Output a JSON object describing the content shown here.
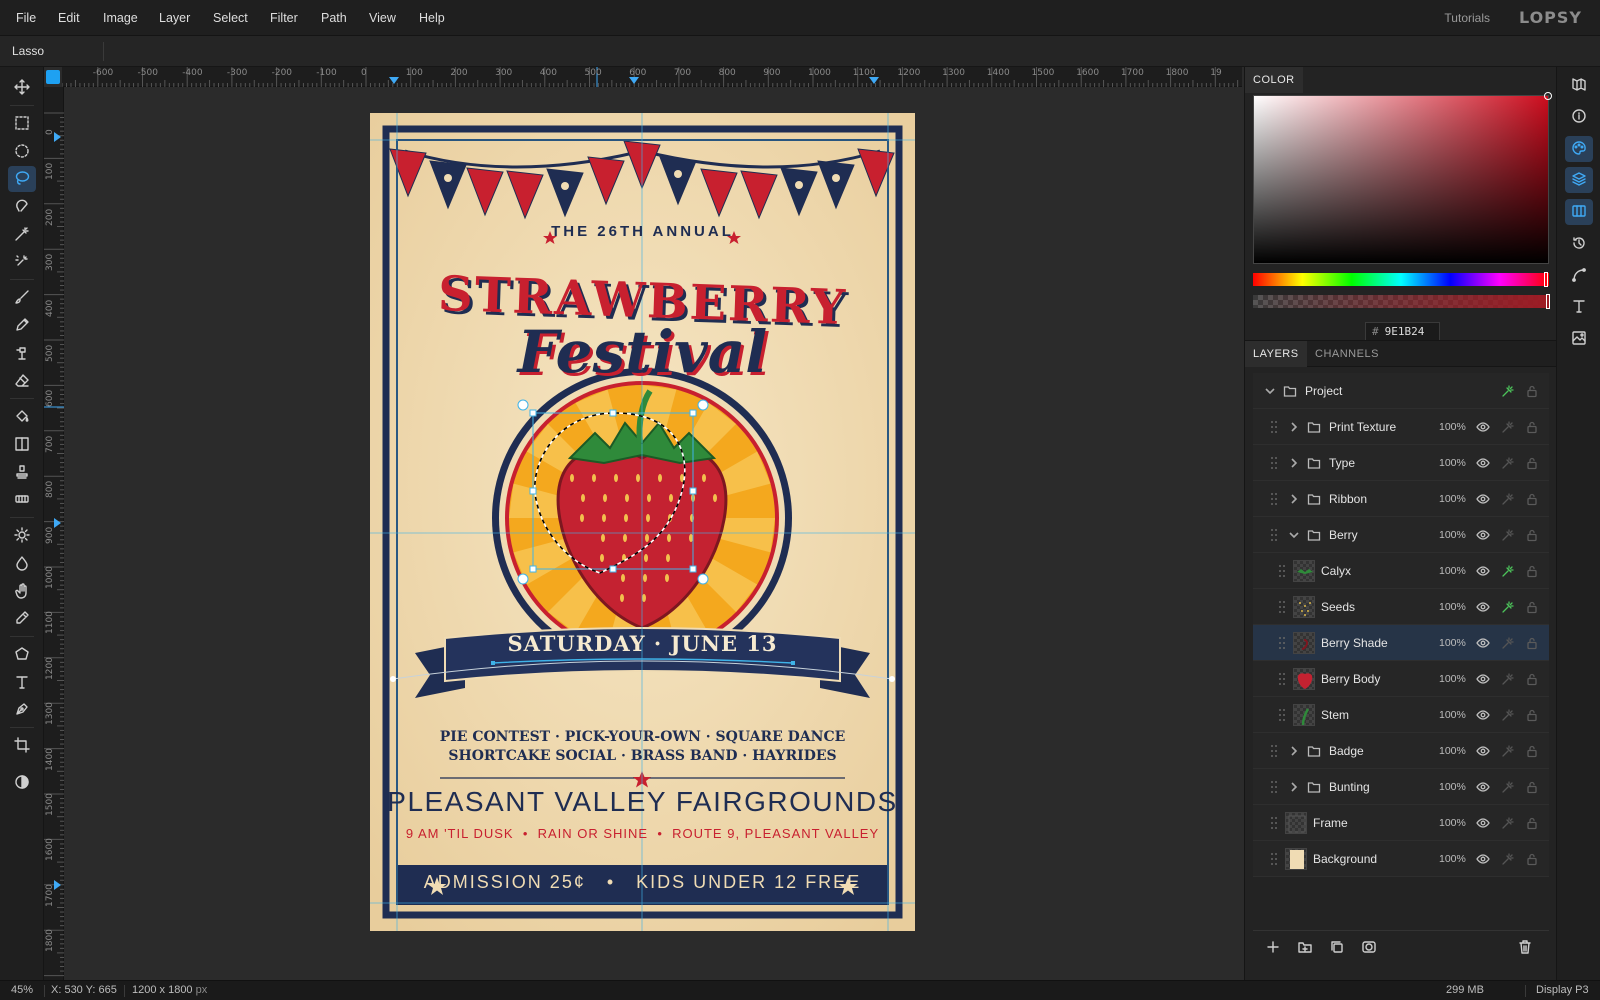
{
  "menu": {
    "items": [
      "File",
      "Edit",
      "Image",
      "Layer",
      "Select",
      "Filter",
      "Path",
      "View",
      "Help"
    ],
    "tutorials": "Tutorials",
    "logo": "LOPSY"
  },
  "options": {
    "tool_name": "Lasso"
  },
  "tools": [
    {
      "name": "move-icon"
    },
    {
      "name": "rect-select-icon"
    },
    {
      "name": "ellipse-select-icon"
    },
    {
      "name": "lasso-icon",
      "active": true
    },
    {
      "name": "magnetic-lasso-icon"
    },
    {
      "name": "magic-wand-icon"
    },
    {
      "name": "quick-select-icon"
    },
    {
      "name": "brush-icon"
    },
    {
      "name": "pencil-icon"
    },
    {
      "name": "clone-icon"
    },
    {
      "name": "eraser-icon"
    },
    {
      "name": "bucket-icon"
    },
    {
      "name": "gradient-icon"
    },
    {
      "name": "stamp-icon"
    },
    {
      "name": "heal-icon"
    },
    {
      "name": "dodge-icon"
    },
    {
      "name": "blur-icon"
    },
    {
      "name": "smudge-icon"
    },
    {
      "name": "eyedropper-icon"
    },
    {
      "name": "shape-icon"
    },
    {
      "name": "text-icon"
    },
    {
      "name": "pen-icon"
    },
    {
      "name": "crop-icon"
    },
    {
      "name": "contrast-icon"
    }
  ],
  "rulers": {
    "top": [
      "-600",
      "-500",
      "-400",
      "-300",
      "-200",
      "-100",
      "0",
      "100",
      "200",
      "300",
      "400",
      "500",
      "600",
      "700",
      "800",
      "900",
      "1000",
      "1100",
      "1200",
      "1300",
      "1400",
      "1500",
      "1600",
      "1700",
      "1800",
      "19"
    ],
    "left": [
      "0",
      "100",
      "200",
      "300",
      "400",
      "500",
      "600",
      "700",
      "800",
      "900",
      "1000",
      "1100",
      "1200",
      "1300",
      "1400",
      "1500",
      "1600",
      "1700",
      "1800"
    ]
  },
  "poster": {
    "subtitle": "THE 26TH ANNUAL",
    "title1": "STRAWBERRY",
    "title2": "Festival",
    "ribbon": "SATURDAY · JUNE 13",
    "events1": "PIE CONTEST · PICK-YOUR-OWN · SQUARE DANCE",
    "events2": "SHORTCAKE SOCIAL · BRASS BAND · HAYRIDES",
    "venue": "PLEASANT VALLEY FAIRGROUNDS",
    "details": "9 AM 'TIL DUSK  •  RAIN OR SHINE  •  ROUTE 9, PLEASANT VALLEY",
    "admission": "ADMISSION 25¢   •   KIDS UNDER 12 FREE",
    "colors": {
      "cream": "#f0dcb4",
      "navy": "#1f2d52",
      "red": "#c8202f",
      "orange": "#f4a81e",
      "green": "#2f8a3a"
    }
  },
  "color_panel": {
    "tab": "COLOR",
    "hex_label": "#",
    "hex": "9E1B24",
    "current_color": "#9e1b24"
  },
  "layers_panel": {
    "tabs": [
      "LAYERS",
      "CHANNELS"
    ],
    "layers": [
      {
        "name": "Project",
        "type": "group",
        "depth": 0,
        "expanded": true,
        "opacity": "",
        "fx": true
      },
      {
        "name": "Print Texture",
        "type": "group",
        "depth": 1,
        "expanded": false,
        "opacity": "100%",
        "fx": false
      },
      {
        "name": "Type",
        "type": "group",
        "depth": 1,
        "expanded": false,
        "opacity": "100%",
        "fx": false
      },
      {
        "name": "Ribbon",
        "type": "group",
        "depth": 1,
        "expanded": false,
        "opacity": "100%",
        "fx": false
      },
      {
        "name": "Berry",
        "type": "group",
        "depth": 1,
        "expanded": true,
        "opacity": "100%",
        "fx": false
      },
      {
        "name": "Calyx",
        "type": "layer",
        "depth": 2,
        "opacity": "100%",
        "fx": true,
        "thumb": "calyx"
      },
      {
        "name": "Seeds",
        "type": "layer",
        "depth": 2,
        "opacity": "100%",
        "fx": true,
        "thumb": "seeds"
      },
      {
        "name": "Berry Shade",
        "type": "layer",
        "depth": 2,
        "opacity": "100%",
        "fx": false,
        "selected": true,
        "thumb": "shade"
      },
      {
        "name": "Berry Body",
        "type": "layer",
        "depth": 2,
        "opacity": "100%",
        "fx": false,
        "thumb": "body"
      },
      {
        "name": "Stem",
        "type": "layer",
        "depth": 2,
        "opacity": "100%",
        "fx": false,
        "thumb": "stem"
      },
      {
        "name": "Badge",
        "type": "group",
        "depth": 1,
        "expanded": false,
        "opacity": "100%",
        "fx": false
      },
      {
        "name": "Bunting",
        "type": "group",
        "depth": 1,
        "expanded": false,
        "opacity": "100%",
        "fx": false
      },
      {
        "name": "Frame",
        "type": "layer",
        "depth": 1,
        "opacity": "100%",
        "fx": false,
        "thumb": "frame"
      },
      {
        "name": "Background",
        "type": "layer",
        "depth": 1,
        "opacity": "100%",
        "fx": false,
        "thumb": "bg"
      }
    ]
  },
  "status": {
    "zoom": "45%",
    "coords": "X: 530 Y: 665",
    "size_value": "1200 x 1800",
    "size_unit": "px",
    "memory": "299 MB",
    "profile": "Display P3"
  }
}
